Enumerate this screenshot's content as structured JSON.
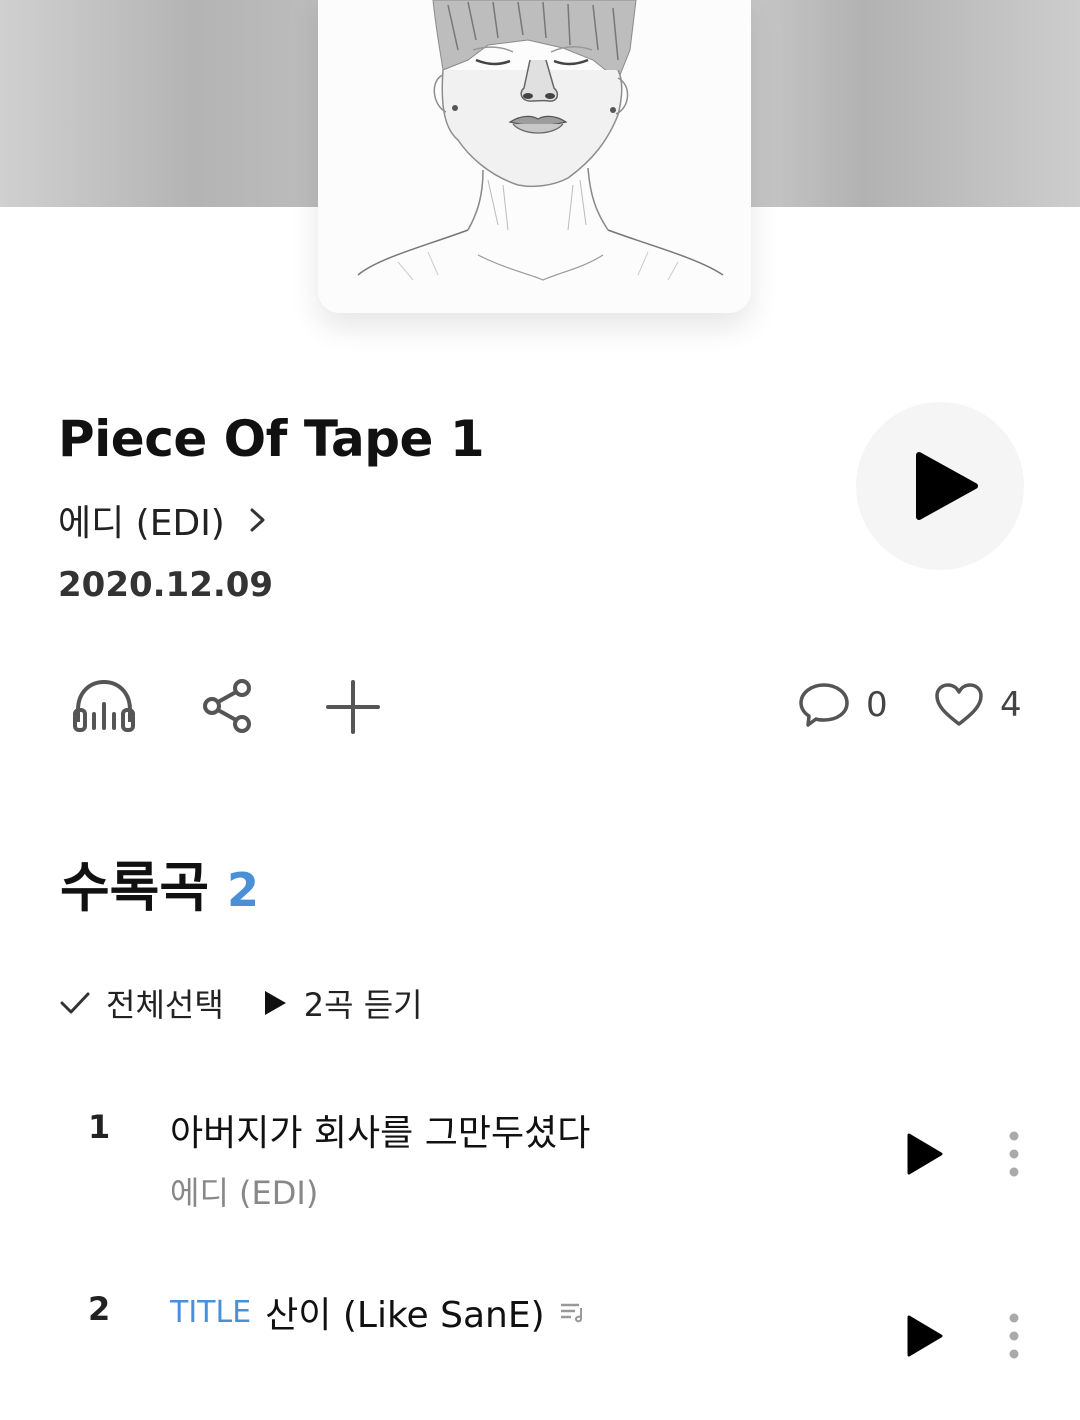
{
  "album": {
    "title": "Piece Of Tape 1",
    "artist": "에디 (EDI)",
    "release_date": "2020.12.09"
  },
  "actions": {
    "comment_count": "0",
    "like_count": "4"
  },
  "tracklist": {
    "heading": "수록곡",
    "count": "2",
    "select_all_label": "전체선택",
    "play_all_label": "2곡 듣기",
    "tracks": [
      {
        "number": "1",
        "title": "아버지가 회사를 그만두셨다",
        "artist": "에디 (EDI)",
        "badge": ""
      },
      {
        "number": "2",
        "title": "산이 (Like SanE)",
        "artist": "",
        "badge": "TITLE"
      }
    ]
  },
  "colors": {
    "accent": "#4a90d9",
    "background": "#ffffff",
    "header_gray": "#c4c4c4"
  },
  "icons": [
    "album-art-sketch",
    "play-icon",
    "chevron-right-icon",
    "headphones-icon",
    "share-icon",
    "add-icon",
    "comment-icon",
    "heart-icon",
    "check-icon",
    "lyrics-icon",
    "more-icon"
  ]
}
